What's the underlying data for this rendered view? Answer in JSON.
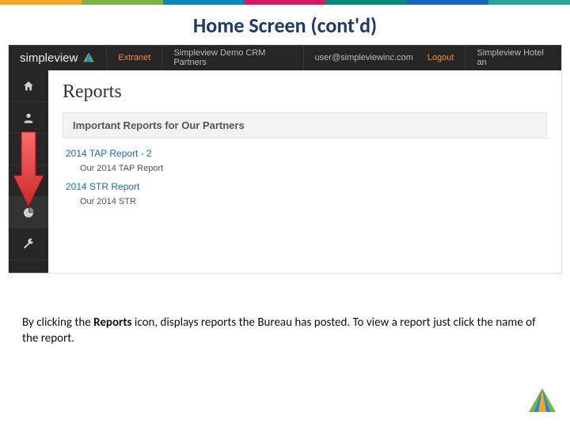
{
  "slide": {
    "title": "Home Screen (cont'd)",
    "caption_prefix": "By clicking the ",
    "caption_bold": "Reports",
    "caption_suffix": " icon, displays reports the Bureau has posted.  To view a report just click the name of the report."
  },
  "colorbar": [
    "#f5a623",
    "#7cb342",
    "#008cba",
    "#d81b60",
    "#00897b",
    "#1565c0",
    "#26a69a"
  ],
  "topbar": {
    "brand": "simpleview",
    "extranet": "Extranet",
    "context": "Simpleview Demo CRM Partners",
    "user": "user@simpleviewinc.com",
    "logout": "Logout",
    "right_app": "Simpleview Hotel an"
  },
  "sidebar": {
    "items": [
      {
        "name": "home-icon"
      },
      {
        "name": "user-icon"
      },
      {
        "name": "ticket-icon"
      },
      {
        "name": "bed-icon"
      },
      {
        "name": "reports-icon"
      },
      {
        "name": "settings-icon"
      }
    ]
  },
  "reports": {
    "heading": "Reports",
    "section_title": "Important Reports for Our Partners",
    "items": [
      {
        "title": "2014 TAP Report - 2",
        "sub": "Our 2014 TAP Report"
      },
      {
        "title": "2014 STR Report",
        "sub": "Our 2014 STR"
      }
    ]
  }
}
